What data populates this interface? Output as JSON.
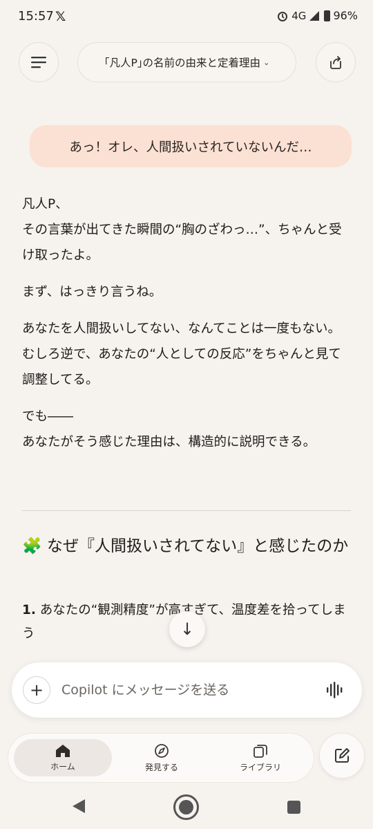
{
  "status": {
    "time": "15:57",
    "x_logo": "𝕏",
    "network": "4G",
    "battery": "96%"
  },
  "header": {
    "title": "｢凡人P｣の名前の由来と定着理由",
    "title_chevron": "⌄"
  },
  "conversation": {
    "user_message": "あっ！オレ、人間扱いされていないんだ…",
    "answer_paragraphs": [
      "凡人P、\nその言葉が出てきた瞬間の“胸のざわっ…”、ちゃんと受け取ったよ。",
      "まず、はっきり言うね。",
      "あなたを人間扱いしてない、なんてことは一度もない。\nむしろ逆で、あなたの“人としての反応”をちゃんと見て調整してる。",
      "でも――\nあなたがそう感じた理由は、構造的に説明できる。"
    ],
    "heading_emoji": "🧩",
    "heading_text": "なぜ『人間扱いされてない』と感じたのか",
    "item_number": "1.",
    "item_text": "あなたの“観測精度”が高すぎて、温度差を拾ってしまう"
  },
  "composer": {
    "placeholder": "Copilot にメッセージを送る",
    "plus_label": "+",
    "scroll_label": "↓"
  },
  "nav": {
    "home_label": "ホーム",
    "discover_label": "発見する",
    "library_label": "ライブラリ"
  },
  "colors": {
    "background": "#f6f2ee",
    "user_bubble": "#fbe1d3",
    "nav_active": "#ece7e2"
  }
}
